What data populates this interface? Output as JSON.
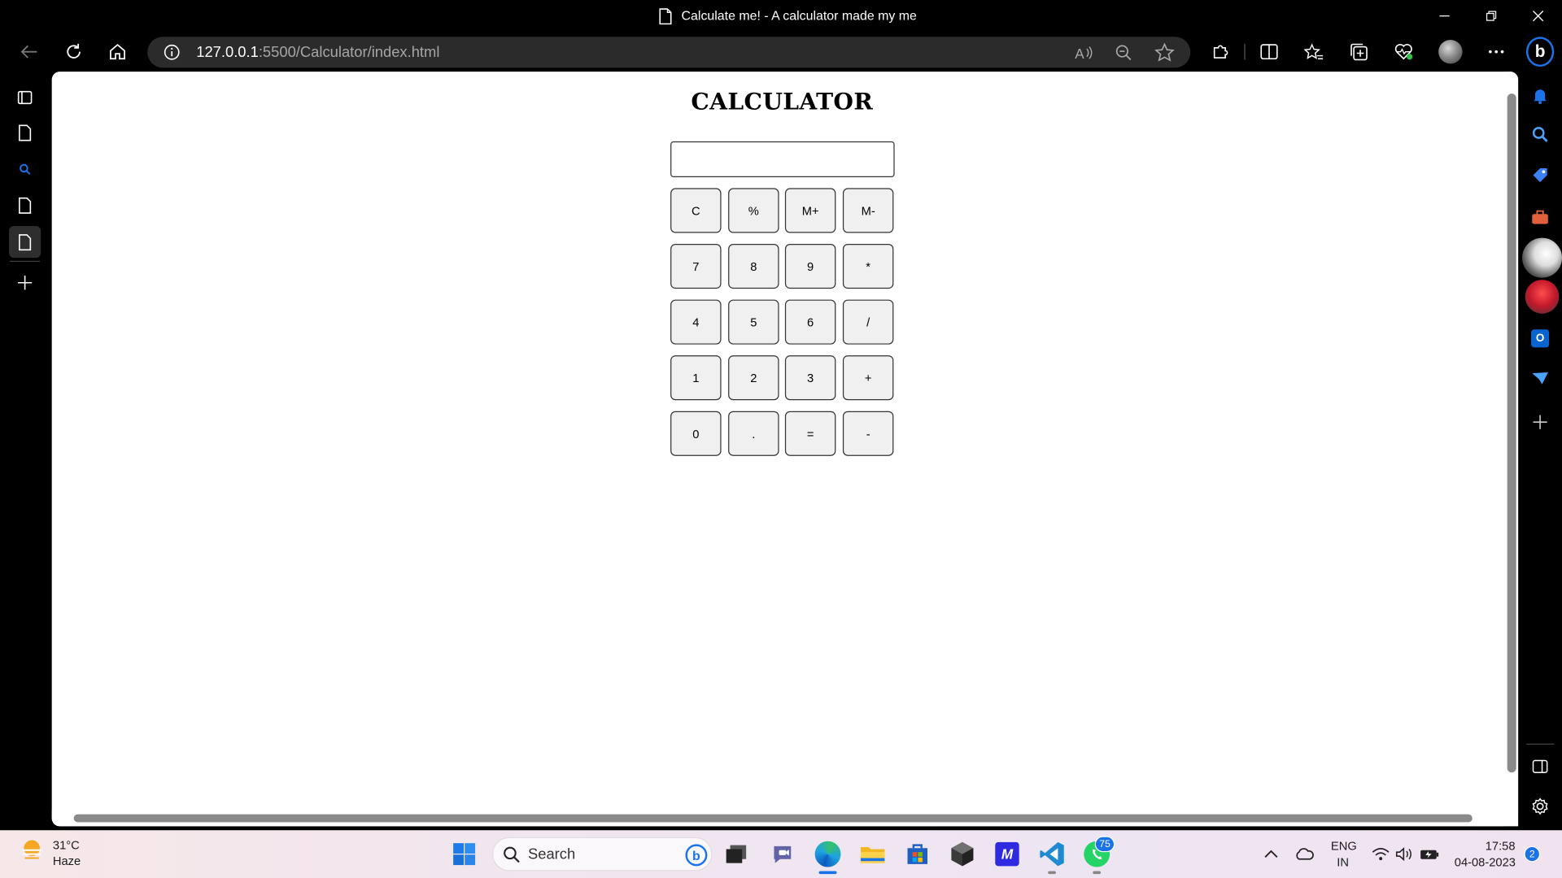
{
  "window": {
    "title": "Calculate me! - A calculator made my me"
  },
  "address_bar": {
    "url_host": "127.0.0.1",
    "url_rest": ":5500/Calculator/index.html"
  },
  "page": {
    "heading": "CALCULATOR",
    "display_value": "",
    "buttons": [
      [
        "C",
        "%",
        "M+",
        "M-"
      ],
      [
        "7",
        "8",
        "9",
        "*"
      ],
      [
        "4",
        "5",
        "6",
        "/"
      ],
      [
        "1",
        "2",
        "3",
        "+"
      ],
      [
        "0",
        ".",
        "=",
        "-"
      ]
    ]
  },
  "taskbar": {
    "weather_temp": "31°C",
    "weather_condition": "Haze",
    "search_label": "Search",
    "whatsapp_badge": "75",
    "language_top": "ENG",
    "language_bottom": "IN",
    "time": "17:58",
    "date": "04-08-2023",
    "notification_count": "2"
  },
  "icons": {
    "title_doc": "document-icon",
    "back": "back-arrow-icon",
    "refresh": "refresh-icon",
    "home": "home-icon",
    "info": "info-icon",
    "read_aloud": "read-aloud-icon",
    "zoom": "zoom-out-icon",
    "favorite": "star-icon",
    "extensions": "puzzle-icon",
    "split": "split-screen-icon",
    "favorites": "favorites-icon",
    "collections": "collections-icon",
    "performance": "heart-pulse-icon",
    "profile": "avatar",
    "more": "more-icon",
    "bing": "bing-icon"
  },
  "colors": {
    "chrome_bg": "#000000",
    "omnibox_bg": "#2b2b2b",
    "accent_blue": "#1a73e8"
  }
}
